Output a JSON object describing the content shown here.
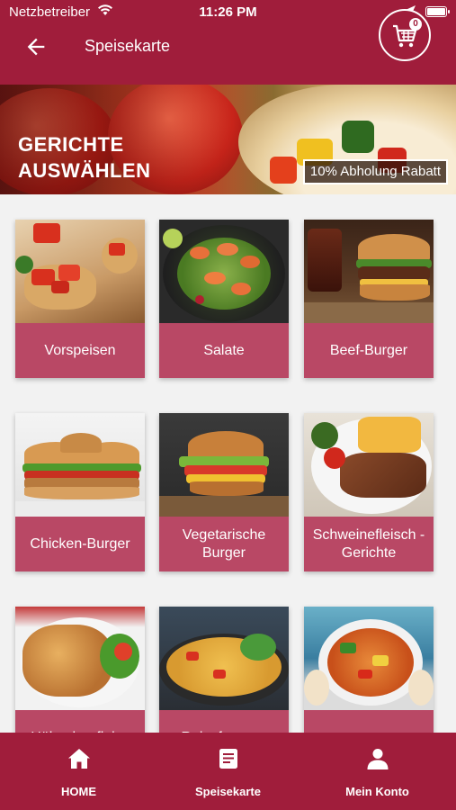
{
  "status_bar": {
    "carrier": "Netzbetreiber",
    "time": "11:26 PM"
  },
  "app_bar": {
    "title": "Speisekarte",
    "cart_count": "0"
  },
  "hero": {
    "headline": "GERICHTE\nAUSWÄHLEN",
    "promo": "10% Abholung Rabatt"
  },
  "categories": [
    {
      "label": "Vorspeisen"
    },
    {
      "label": "Salate"
    },
    {
      "label": "Beef-Burger"
    },
    {
      "label": "Chicken-Burger"
    },
    {
      "label": "Vegetarische Burger"
    },
    {
      "label": "Schweinefleisch -Gerichte"
    },
    {
      "label": "Hähnchenfleisc"
    },
    {
      "label": "Reispfannen-"
    },
    {
      "label": ""
    }
  ],
  "bottom_nav": [
    {
      "label": "HOME",
      "icon": "home-icon"
    },
    {
      "label": "Speisekarte",
      "icon": "menu-book-icon"
    },
    {
      "label": "Mein Konto",
      "icon": "person-icon"
    }
  ],
  "colors": {
    "primary": "#a01d3b",
    "card_label": "#b94865",
    "grid_background": "#f2f2f2"
  }
}
